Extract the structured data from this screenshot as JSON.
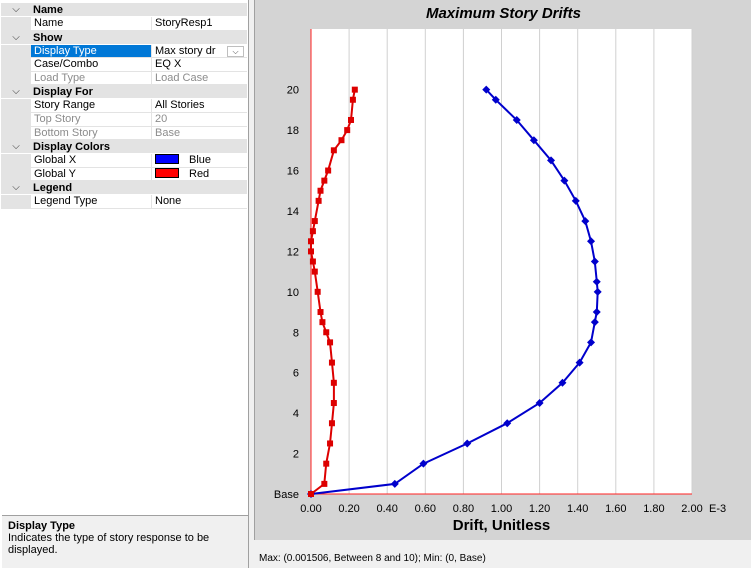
{
  "property_grid": {
    "categories": [
      {
        "label": "Name",
        "rows": [
          {
            "name": "Name",
            "value": "StoryResp1"
          }
        ]
      },
      {
        "label": "Show",
        "rows": [
          {
            "name": "Display Type",
            "value": "Max story dr",
            "selected": true,
            "dropdown": true
          },
          {
            "name": "Case/Combo",
            "value": "EQ X"
          },
          {
            "name": "Load Type",
            "value": "Load Case",
            "disabled": true
          }
        ]
      },
      {
        "label": "Display For",
        "rows": [
          {
            "name": "Story Range",
            "value": "All Stories"
          },
          {
            "name": "Top Story",
            "value": "20",
            "disabled": true
          },
          {
            "name": "Bottom Story",
            "value": "Base",
            "disabled": true
          }
        ]
      },
      {
        "label": "Display Colors",
        "rows": [
          {
            "name": "Global X",
            "value": "Blue",
            "swatch": "#0000ff"
          },
          {
            "name": "Global Y",
            "value": "Red",
            "swatch": "#ff0000"
          }
        ]
      },
      {
        "label": "Legend",
        "rows": [
          {
            "name": "Legend Type",
            "value": "None"
          }
        ]
      }
    ],
    "icons": {
      "category_toggle": "chevron-down-icon",
      "dropdown": "chevron-down-icon"
    }
  },
  "description": {
    "title": "Display Type",
    "text": "Indicates the type of story response to be displayed."
  },
  "status": "Max: (0.001506, Between 8 and 10);   Min: (0, Base)",
  "chart_data": {
    "type": "line",
    "title": "Maximum Story Drifts",
    "xlabel": "Drift, Unitless",
    "x_unit_suffix": "E-3",
    "xlim": [
      0,
      2.0
    ],
    "ylim": [
      0,
      23
    ],
    "x_ticks": [
      "0.00",
      "0.20",
      "0.40",
      "0.60",
      "0.80",
      "1.00",
      "1.20",
      "1.40",
      "1.60",
      "1.80",
      "2.00"
    ],
    "y_ticks": [
      {
        "value": 0,
        "label": "Base"
      },
      {
        "value": 2,
        "label": "2"
      },
      {
        "value": 4,
        "label": "4"
      },
      {
        "value": 6,
        "label": "6"
      },
      {
        "value": 8,
        "label": "8"
      },
      {
        "value": 10,
        "label": "10"
      },
      {
        "value": 12,
        "label": "12"
      },
      {
        "value": 14,
        "label": "14"
      },
      {
        "value": 16,
        "label": "16"
      },
      {
        "value": 18,
        "label": "18"
      },
      {
        "value": 20,
        "label": "20"
      }
    ],
    "grid": true,
    "series": [
      {
        "color": "#0000cc",
        "marker": "diamond",
        "x": [
          0.0,
          0.44,
          0.59,
          0.82,
          1.03,
          1.2,
          1.32,
          1.41,
          1.47,
          1.49,
          1.5,
          1.505,
          1.5,
          1.49,
          1.47,
          1.44,
          1.39,
          1.33,
          1.26,
          1.17,
          1.08,
          0.97,
          0.92
        ],
        "y": [
          0,
          0.5,
          1.5,
          2.5,
          3.5,
          4.5,
          5.5,
          6.5,
          7.5,
          8.5,
          9.0,
          10.0,
          10.5,
          11.5,
          12.5,
          13.5,
          14.5,
          15.5,
          16.5,
          17.5,
          18.5,
          19.5,
          20
        ]
      },
      {
        "color": "#dd0000",
        "marker": "square",
        "x": [
          0.0,
          0.07,
          0.08,
          0.1,
          0.11,
          0.12,
          0.12,
          0.11,
          0.1,
          0.08,
          0.06,
          0.05,
          0.035,
          0.02,
          0.01,
          0.0,
          0.0,
          0.01,
          0.02,
          0.04,
          0.05,
          0.07,
          0.09,
          0.12,
          0.16,
          0.19,
          0.21,
          0.22,
          0.23
        ],
        "y": [
          0,
          0.5,
          1.5,
          2.5,
          3.5,
          4.5,
          5.5,
          6.5,
          7.5,
          8.0,
          8.5,
          9.0,
          10.0,
          11.0,
          11.5,
          12.0,
          12.5,
          13.0,
          13.5,
          14.5,
          15.0,
          15.5,
          16.0,
          17.0,
          17.5,
          18.0,
          18.5,
          19.5,
          20
        ]
      }
    ]
  }
}
